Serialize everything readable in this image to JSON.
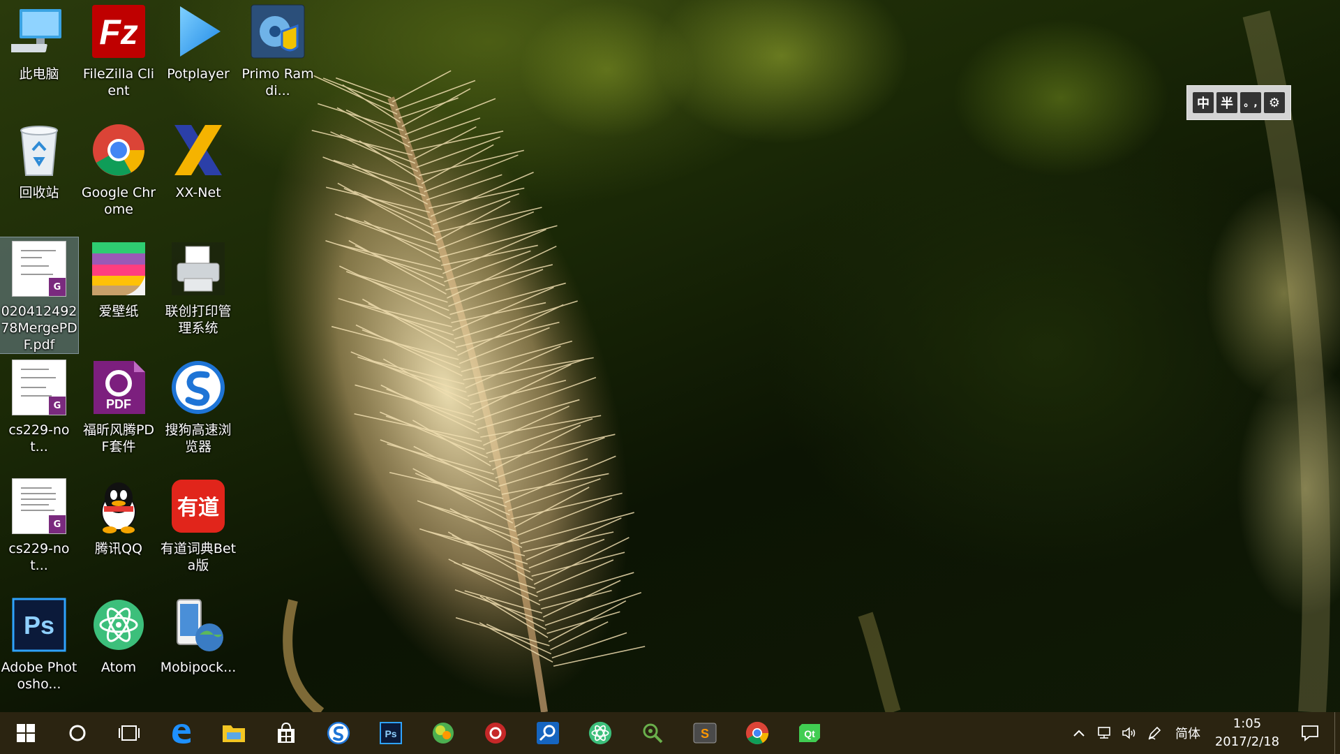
{
  "desktop": {
    "icons": [
      {
        "label": "此电脑",
        "icon": "computer-icon"
      },
      {
        "label": "FileZilla Client",
        "icon": "filezilla-icon"
      },
      {
        "label": "Potplayer",
        "icon": "potplayer-icon"
      },
      {
        "label": "Primo Ramdi...",
        "icon": "primo-ramdisk-icon"
      },
      {
        "label": "回收站",
        "icon": "recycle-bin-icon"
      },
      {
        "label": "Google Chrome",
        "icon": "chrome-icon"
      },
      {
        "label": "XX-Net",
        "icon": "xx-net-icon"
      },
      {
        "label": "02041249278MergePDF.pdf",
        "icon": "pdf-file-icon"
      },
      {
        "label": "爱壁纸",
        "icon": "wallpaper-app-icon"
      },
      {
        "label": "联创打印管理系统",
        "icon": "printer-icon"
      },
      {
        "label": "cs229-not...",
        "icon": "pdf-file-icon"
      },
      {
        "label": "福昕风腾PDF套件",
        "icon": "foxit-pdf-icon"
      },
      {
        "label": "搜狗高速浏览器",
        "icon": "sogou-browser-icon"
      },
      {
        "label": "cs229-not...",
        "icon": "pdf-file-icon"
      },
      {
        "label": "腾讯QQ",
        "icon": "qq-icon"
      },
      {
        "label": "有道词典Beta版",
        "icon": "youdao-icon"
      },
      {
        "label": "Adobe Photosho...",
        "icon": "photoshop-icon"
      },
      {
        "label": "Atom",
        "icon": "atom-icon"
      },
      {
        "label": "Mobipock...",
        "icon": "mobipocket-icon"
      }
    ],
    "selected_index": 7
  },
  "ime_bar": {
    "buttons": [
      "中",
      "半",
      "。,",
      "⚙"
    ]
  },
  "taskbar": {
    "apps": [
      "edge-icon",
      "file-explorer-icon",
      "store-icon",
      "sogou-browser-icon",
      "photoshop-icon",
      "green-app-icon",
      "red-app-icon",
      "search-app-icon",
      "atom-icon",
      "network-app-icon",
      "sublime-icon",
      "chrome-icon",
      "qt-icon"
    ],
    "tray": {
      "ime_label": "简体",
      "time": "1:05",
      "date": "2017/2/18"
    }
  },
  "colors": {
    "taskbar": "#2b2411",
    "selection": "#a0bee6"
  }
}
